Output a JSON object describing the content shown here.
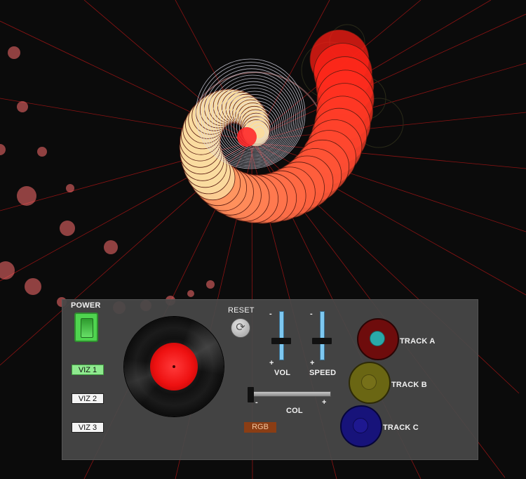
{
  "controls": {
    "power_label": "POWER",
    "reset_label": "RESET",
    "vol_label": "VOL",
    "speed_label": "SPEED",
    "col_label": "COL",
    "minus": "-",
    "plus": "+",
    "rgb_label": "RGB",
    "viz_buttons": [
      "VIZ 1",
      "VIZ 2",
      "VIZ 3"
    ],
    "active_viz": "VIZ 1",
    "tracks": [
      {
        "label": "TRACK A",
        "color": "#7a0f0f",
        "center": "#2aa8a8"
      },
      {
        "label": "TRACK B",
        "color": "#6f6a14",
        "center": "#6f6a14"
      },
      {
        "label": "TRACK C",
        "color": "#1a1578",
        "center": "#1a1578"
      }
    ],
    "vol_level": 0.4,
    "speed_level": 0.4,
    "col_level": 0.0,
    "power_on": true
  },
  "colors": {
    "accent_green": "#8ee98e",
    "slider_blue": "#7ec8f0",
    "record_label": "#e11111",
    "background": "#0b0b0b"
  }
}
